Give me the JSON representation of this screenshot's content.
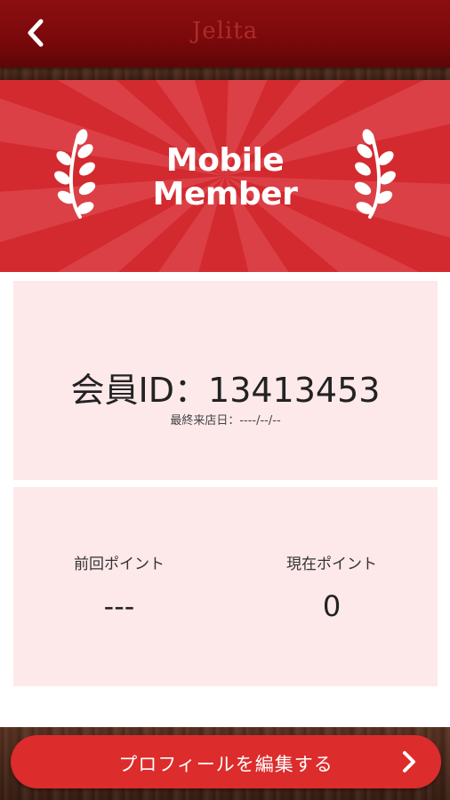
{
  "header": {
    "title": "Jelita",
    "back_icon": "chevron-left-icon"
  },
  "banner": {
    "line1": "Mobile",
    "line2": "Member",
    "icon": "laurel-icon",
    "color": "#d32a2f"
  },
  "member": {
    "id_text": "会員ID：13413453",
    "last_visit": "最終来店日：----/--/--"
  },
  "points": {
    "previous_label": "前回ポイント",
    "previous_value": "---",
    "current_label": "現在ポイント",
    "current_value": "0"
  },
  "footer": {
    "button_label": "プロフィールを編集する",
    "chevron_icon": "chevron-right-icon",
    "color": "#dc2c2c"
  }
}
